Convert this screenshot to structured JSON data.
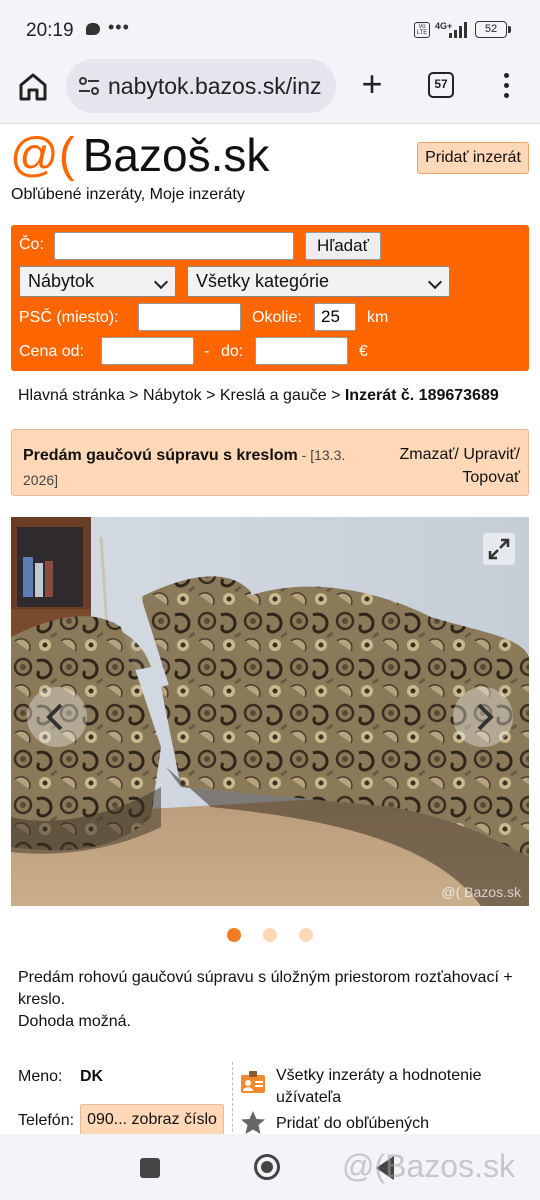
{
  "status_bar": {
    "time": "20:19",
    "dots": "•••",
    "network": "4G+",
    "volte": "Vo LTE",
    "battery": "52"
  },
  "browser": {
    "url": "nabytok.bazos.sk/inz",
    "plus": "+",
    "tab_count": "57"
  },
  "site": {
    "logo_symbol": "@(",
    "logo_text": "Bazoš.sk",
    "post_ad_label": "Pridať inzerát",
    "fav_links": "Obľúbené inzeráty, Moje inzeráty",
    "brand_color": "#ff6600"
  },
  "search": {
    "query_label": "Čo:",
    "query_value": "",
    "search_button": "Hľadať",
    "category_selected": "Nábytok",
    "subcategory_selected": "Všetky kategórie",
    "psc_label": "PSČ  (miesto):",
    "psc_value": "",
    "radius_label": "Okolie:",
    "radius_value": "25",
    "radius_unit": "km",
    "price_label": "Cena  od:",
    "price_from": "",
    "price_sep": "-",
    "price_to_label": "do:",
    "price_to": "",
    "currency": "€"
  },
  "breadcrumb": {
    "path": "Hlavná stránka > Nábytok > Kreslá a gauče > ",
    "current": "Inzerát č. 189673689"
  },
  "listing": {
    "title": "Predám gaučovú súpravu s kreslom",
    "date_prefix": " - [13.3.",
    "date_suffix": "2026]",
    "actions_line1": "Zmazať/ Upraviť/",
    "actions_line2": "Topovať",
    "watermark": "@( Bazos.sk",
    "image_count": 3,
    "active_image": 1,
    "description_line1": "Predám rohovú gaučovú súpravu s úložným priestorom rozťahovací + kreslo.",
    "description_line2": "Dohoda možná.",
    "name_label": "Meno:",
    "name_value": "DK",
    "phone_label": "Telefón:",
    "phone_button": "090... zobraz číslo",
    "all_ads_link": "Všetky inzeráty a hodnotenie užívateľa",
    "favorite_link": "Pridať do obľúbených"
  },
  "nav_watermark": "@(Bazos.sk"
}
